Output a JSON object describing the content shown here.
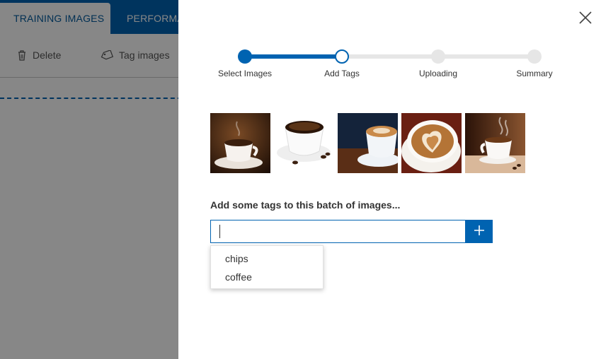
{
  "background": {
    "tabs": [
      {
        "label": "TRAINING IMAGES"
      },
      {
        "label": "PERFORMA"
      }
    ],
    "toolbar": {
      "delete_label": "Delete",
      "tag_label": "Tag images"
    }
  },
  "panel": {
    "steps": [
      {
        "label": "Select Images",
        "state": "complete"
      },
      {
        "label": "Add Tags",
        "state": "current"
      },
      {
        "label": "Uploading",
        "state": "pending"
      },
      {
        "label": "Summary",
        "state": "pending"
      }
    ],
    "images": [
      {
        "alt": "coffee-cup-dark"
      },
      {
        "alt": "coffee-cup-beans"
      },
      {
        "alt": "latte-cup-blue"
      },
      {
        "alt": "latte-art-heart"
      },
      {
        "alt": "steaming-coffee-cup"
      }
    ],
    "prompt": "Add some tags to this batch of images...",
    "tag_input": {
      "value": "",
      "placeholder": ""
    },
    "suggestions": [
      "chips",
      "coffee"
    ]
  },
  "colors": {
    "accent": "#0063b1",
    "track_inactive": "#e6e6e6",
    "overlay": "rgba(0,0,0,0.47)"
  }
}
